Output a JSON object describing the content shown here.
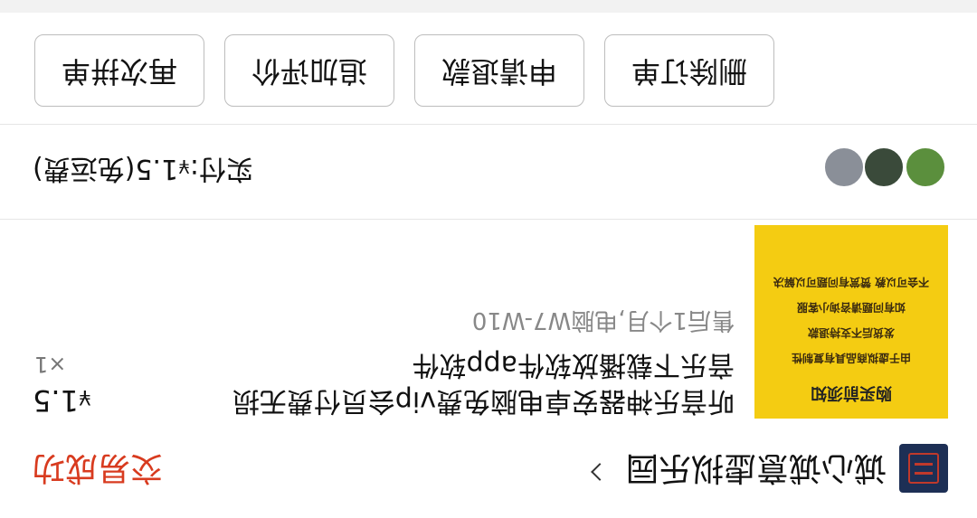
{
  "shop": {
    "name": "诚心诚意虚拟乐园",
    "order_status": "交易成功",
    "logo_text": "诚心诚意"
  },
  "item": {
    "title": "听音乐神器安卓电脑免费vip会员付费无损音乐下载播放软件app软件",
    "spec": "售后1个月,电脑W7-W10",
    "price_symbol": "¥",
    "price_value": "1.5",
    "quantity": "×1",
    "thumbnail": {
      "title": "购买前须知",
      "lines": [
        "由于虚拟商品具有复制性",
        "发货后不支持退款",
        "如有问题请咨询小客服",
        "不会可以教 赞赏有问题可以解决"
      ]
    }
  },
  "payment": {
    "label": "实付:",
    "symbol": "¥",
    "amount": "1.5",
    "shipping": "(免运费)"
  },
  "actions": {
    "delete_order": "删除订单",
    "apply_refund": "申请退款",
    "add_review": "追加评价",
    "buy_again": "再次拼单"
  },
  "colors": {
    "status": "#d83b1f",
    "thumbnail_bg": "#f4cc12",
    "logo_bg": "#1d2f55"
  }
}
